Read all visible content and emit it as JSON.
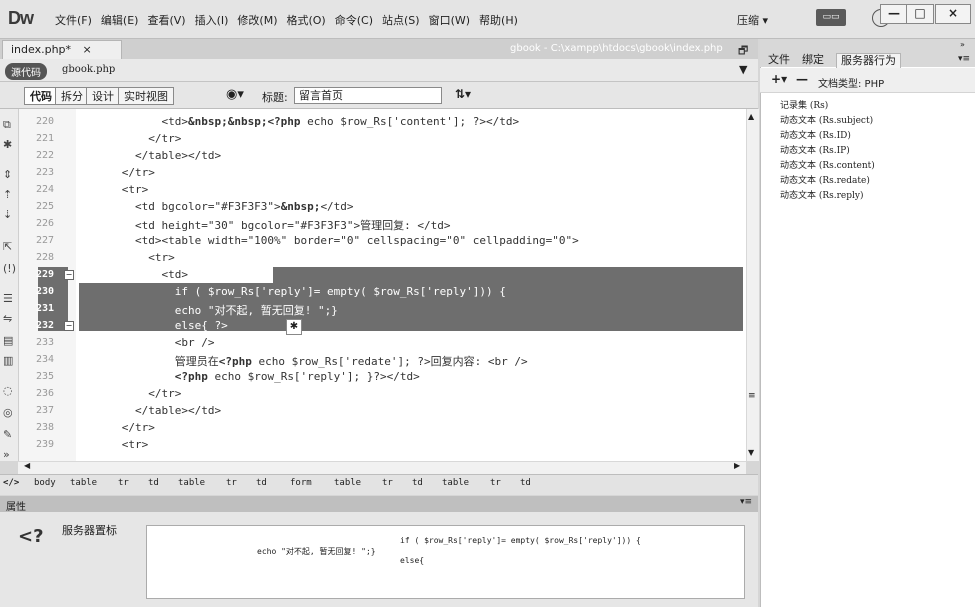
{
  "app": {
    "logo": "Dw"
  },
  "menu": [
    "文件(F)",
    "编辑(E)",
    "查看(V)",
    "插入(I)",
    "修改(M)",
    "格式(O)",
    "命令(C)",
    "站点(S)",
    "窗口(W)",
    "帮助(H)"
  ],
  "window": {
    "compress_label": "压缩",
    "minimize": "—",
    "maximize": "□",
    "close": "×"
  },
  "document": {
    "tab_label": "index.php*",
    "tab_close": "×",
    "path": "gbook - C:\\xampp\\htdocs\\gbook\\index.php",
    "source_pill": "源代码",
    "related_file": "gbook.php"
  },
  "toolbar": {
    "code": "代码",
    "split": "拆分",
    "design": "设计",
    "live_view": "实时视图",
    "title_label": "标题:",
    "title_value": "留言首页"
  },
  "line_numbers": [
    "220",
    "221",
    "222",
    "223",
    "224",
    "225",
    "226",
    "227",
    "228",
    "229",
    "230",
    "231",
    "232",
    "233",
    "234",
    "235",
    "236",
    "237",
    "238",
    "239"
  ],
  "code_lines": [
    {
      "pre": "            <td>",
      "kw": "&nbsp;&nbsp;<?php",
      "post": " echo $row_Rs['content']; ?></td>"
    },
    {
      "pre": "          </tr>",
      "kw": "",
      "post": ""
    },
    {
      "pre": "        </table></td>",
      "kw": "",
      "post": ""
    },
    {
      "pre": "      </tr>",
      "kw": "",
      "post": ""
    },
    {
      "pre": "      <tr>",
      "kw": "",
      "post": ""
    },
    {
      "pre": "        <td bgcolor=\"#F3F3F3\">",
      "kw": "&nbsp;",
      "post": "</td>"
    },
    {
      "pre": "        <td height=\"30\" bgcolor=\"#F3F3F3\">管理回复: </td>",
      "kw": "",
      "post": ""
    },
    {
      "pre": "        <td><table width=\"100%\" border=\"0\" cellspacing=\"0\" cellpadding=\"0\">",
      "kw": "",
      "post": ""
    },
    {
      "pre": "          <tr>",
      "kw": "",
      "post": ""
    },
    {
      "pre": "            <td>",
      "kw": "<?php",
      "post": ""
    },
    {
      "pre": "              if ( $row_Rs['reply']= empty( $row_Rs['reply'])) {",
      "kw": "",
      "post": ""
    },
    {
      "pre": "              echo \"对不起, 暂无回复! \";}",
      "kw": "",
      "post": ""
    },
    {
      "pre": "              else{ ?>",
      "kw": "",
      "post": ""
    },
    {
      "pre": "              <br />",
      "kw": "",
      "post": ""
    },
    {
      "pre": "              管理员在",
      "kw": "<?php",
      "post": " echo $row_Rs['redate']; ?>回复内容: <br />"
    },
    {
      "pre": "              ",
      "kw": "<?php",
      "post": " echo $row_Rs['reply']; }?></td>"
    },
    {
      "pre": "          </tr>",
      "kw": "",
      "post": ""
    },
    {
      "pre": "        </table></td>",
      "kw": "",
      "post": ""
    },
    {
      "pre": "      </tr>",
      "kw": "",
      "post": ""
    },
    {
      "pre": "      <tr>",
      "kw": "",
      "post": ""
    }
  ],
  "tag_selector": [
    "</>",
    "body",
    "table",
    "tr",
    "td",
    "table",
    "tr",
    "td",
    "form",
    "table",
    "tr",
    "td",
    "table",
    "tr",
    "td"
  ],
  "properties": {
    "header": "属性",
    "label": "服务器置标",
    "icon_text": "<?",
    "code_line1": "if ( $row_Rs['reply']= empty( $row_Rs['reply'])) {",
    "code_line2": "echo \"对不起, 暂无回复! \";}",
    "code_line3": "else{"
  },
  "right_panel": {
    "tabs": [
      "文件",
      "绑定",
      "服务器行为"
    ],
    "add": "+",
    "remove": "—",
    "doc_type": "文档类型: PHP",
    "items": [
      "记录集 (Rs)",
      "动态文本 (Rs.subject)",
      "动态文本 (Rs.ID)",
      "动态文本 (Rs.IP)",
      "动态文本 (Rs.content)",
      "动态文本 (Rs.redate)",
      "动态文本 (Rs.reply)"
    ]
  },
  "colors": {
    "selection": "#6e6e6e"
  }
}
